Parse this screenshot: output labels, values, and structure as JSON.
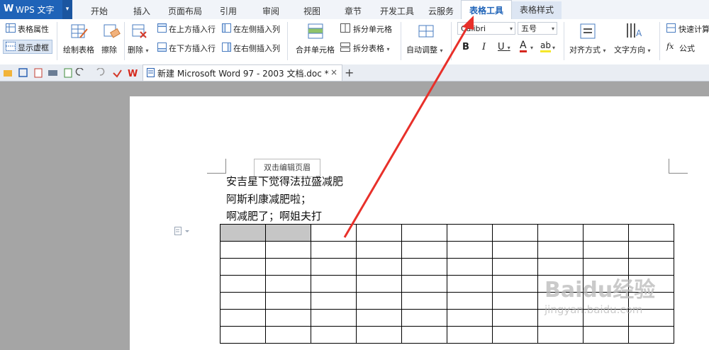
{
  "app": {
    "name": "WPS 文字",
    "logo_letter": "W"
  },
  "menu_tabs": [
    "开始",
    "插入",
    "页面布局",
    "引用",
    "审阅",
    "视图",
    "章节",
    "开发工具",
    "云服务",
    "表格工具",
    "表格样式"
  ],
  "active_tab": "表格工具",
  "ribbon": {
    "table_properties": "表格属性",
    "show_gridlines": "显示虚框",
    "draw_table": "绘制表格",
    "eraser": "擦除",
    "delete": "删除",
    "insert_above": "在上方插入行",
    "insert_below": "在下方插入行",
    "insert_left": "在左侧插入列",
    "insert_right": "在右侧插入列",
    "merge_cells": "合并单元格",
    "split_cells": "拆分单元格",
    "split_table": "拆分表格",
    "autofit": "自动调整",
    "font_name": "Calibri",
    "font_size": "五号",
    "bold": "B",
    "italic": "I",
    "underline": "U",
    "font_color": "A",
    "highlight": "ab",
    "align": "对齐方式",
    "text_direction": "文字方向",
    "quick_calc": "快速计算",
    "formula_prefix": "fx",
    "formula": "公式"
  },
  "doc_tab": {
    "title": "新建 Microsoft Word 97 - 2003 文档.doc *",
    "close": "×",
    "new_tab": "+"
  },
  "page": {
    "header_tip": "双击编辑页眉",
    "lines": [
      "安吉星下觉得法拉盛减肥",
      "阿斯利康减肥啦；",
      "啊减肥了；啊姐夫打"
    ]
  },
  "table": {
    "rows": 7,
    "cols": 10,
    "selected_row0_cells": 2
  },
  "watermark": {
    "text": "Baidu经验",
    "sub": "jingyan.baidu.com"
  },
  "colors": {
    "brand": "#1f63b8",
    "arrow": "#e8302a",
    "selection": "#c6c6c6"
  }
}
